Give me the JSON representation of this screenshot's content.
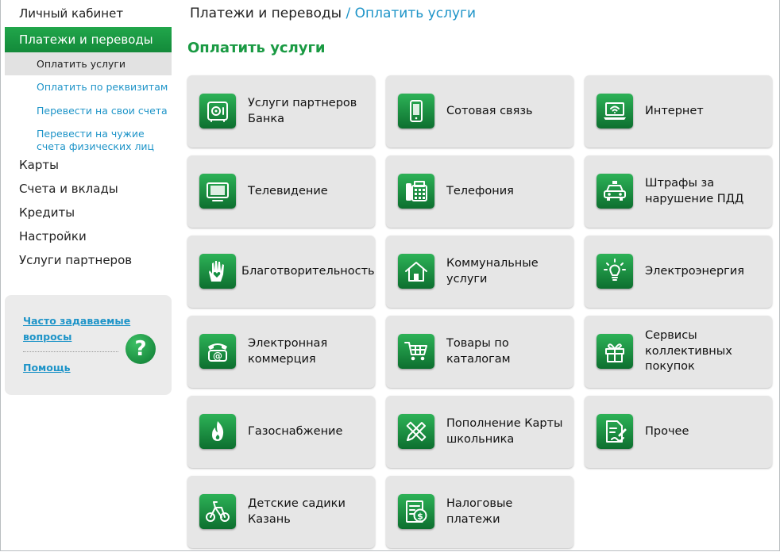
{
  "sidebar": {
    "top_item": "Личный кабинет",
    "active_section": "Платежи и переводы",
    "sub_items": [
      "Оплатить услуги",
      "Оплатить по реквизитам",
      "Перевести на свои счета",
      "Перевести на чужие счета физических лиц"
    ],
    "sub_item_last_line1": "Перевести на чужие",
    "sub_item_last_line2": "счета физических лиц",
    "main_items": [
      "Карты",
      "Счета и вклады",
      "Кредиты",
      "Настройки",
      "Услуги партнеров"
    ],
    "help": {
      "faq_line1": "Часто задаваемые",
      "faq_line2": "вопросы",
      "help_link": "Помощь",
      "question_icon": "question-icon",
      "question_glyph": "?"
    }
  },
  "breadcrumb": {
    "parent": "Платежи и переводы",
    "separator": "/",
    "current": "Оплатить услуги"
  },
  "page_title": "Оплатить услуги",
  "services": [
    {
      "label": "Услуги партнеров Банка",
      "icon": "safe-icon"
    },
    {
      "label": "Сотовая связь",
      "icon": "mobile-phone-icon"
    },
    {
      "label": "Интернет",
      "icon": "laptop-wifi-icon"
    },
    {
      "label": "Телевидение",
      "icon": "tv-icon"
    },
    {
      "label": "Телефония",
      "icon": "fax-phone-icon"
    },
    {
      "label": "Штрафы за нарушение ПДД",
      "icon": "police-car-icon"
    },
    {
      "label": "Благотворительность",
      "icon": "hand-heart-icon"
    },
    {
      "label": "Коммунальные услуги",
      "icon": "house-icon"
    },
    {
      "label": "Электроэнергия",
      "icon": "light-bulb-icon"
    },
    {
      "label": "Электронная коммерция",
      "icon": "at-phone-icon"
    },
    {
      "label": "Товары по каталогам",
      "icon": "shopping-cart-icon"
    },
    {
      "label": "Сервисы коллективных покупок",
      "icon": "gift-icon"
    },
    {
      "label": "Газоснабжение",
      "icon": "flame-icon"
    },
    {
      "label": "Пополнение Карты школьника",
      "icon": "pencil-ruler-icon"
    },
    {
      "label": "Прочее",
      "icon": "document-pen-icon"
    },
    {
      "label": "Детские садики Казань",
      "icon": "tricycle-icon"
    },
    {
      "label": "Налоговые платежи",
      "icon": "tax-document-icon"
    }
  ],
  "colors": {
    "accent_green": "#1a9a43",
    "link_blue": "#1e94c8",
    "tile_bg": "#e6e6e6"
  }
}
